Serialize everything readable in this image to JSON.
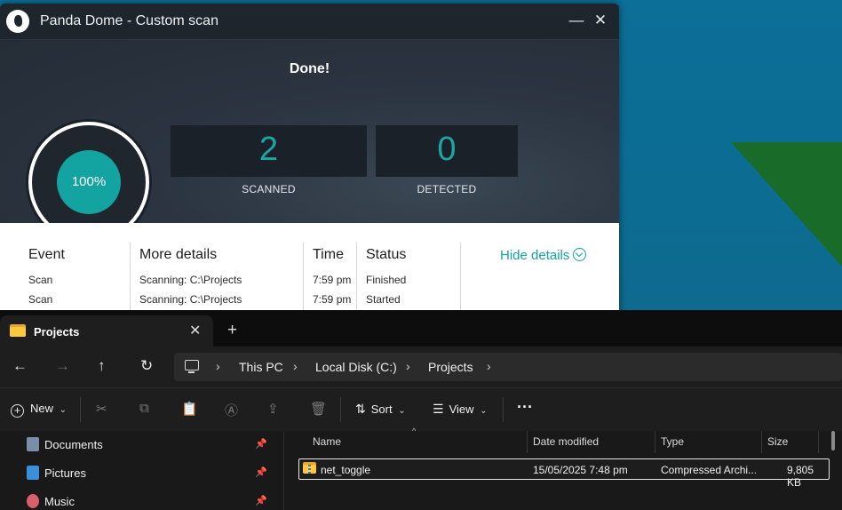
{
  "panda": {
    "title": "Panda Dome - Custom scan",
    "minimize": "—",
    "close": "✕",
    "status": "Done!",
    "progress_label": "100%",
    "progress": 1.0,
    "scanned": {
      "value": "2",
      "label": "SCANNED"
    },
    "detected": {
      "value": "0",
      "label": "DETECTED"
    },
    "columns": [
      "Event",
      "More details",
      "Time",
      "Status"
    ],
    "rows": [
      {
        "event": "Scan",
        "details": "Scanning: C:\\Projects",
        "time": "7:59 pm",
        "status": "Finished"
      },
      {
        "event": "Scan",
        "details": "Scanning: C:\\Projects",
        "time": "7:59 pm",
        "status": "Started"
      }
    ],
    "hide_details": "Hide details",
    "accent": "#14a3a0"
  },
  "explorer": {
    "tab_title": "Projects",
    "tab_close": "✕",
    "tab_new": "+",
    "nav": {
      "back": "←",
      "forward": "→",
      "up": "↑",
      "refresh": "↻"
    },
    "breadcrumbs": [
      "This PC",
      "Local Disk (C:)",
      "Projects"
    ],
    "crumb_sep": "›",
    "toolbar": {
      "new_label": "New",
      "new_caret": "⌄",
      "sort_label": "Sort",
      "view_label": "View",
      "more_label": "···",
      "cut": "✂",
      "copy": "⧉",
      "paste": "📋",
      "rename": "Ⓐ",
      "share": "⇪",
      "delete": "🗑"
    },
    "sidebar": [
      {
        "label": "Documents",
        "icon": "documents-icon",
        "pin": "📌"
      },
      {
        "label": "Pictures",
        "icon": "pictures-icon",
        "pin": "📌"
      },
      {
        "label": "Music",
        "icon": "music-icon",
        "pin": "📌"
      }
    ],
    "columns": [
      "Name",
      "Date modified",
      "Type",
      "Size"
    ],
    "sort_caret": "^",
    "files": [
      {
        "name": "net_toggle",
        "date": "15/05/2025 7:48 pm",
        "type": "Compressed Archi...",
        "size": "9,805 KB"
      }
    ]
  }
}
